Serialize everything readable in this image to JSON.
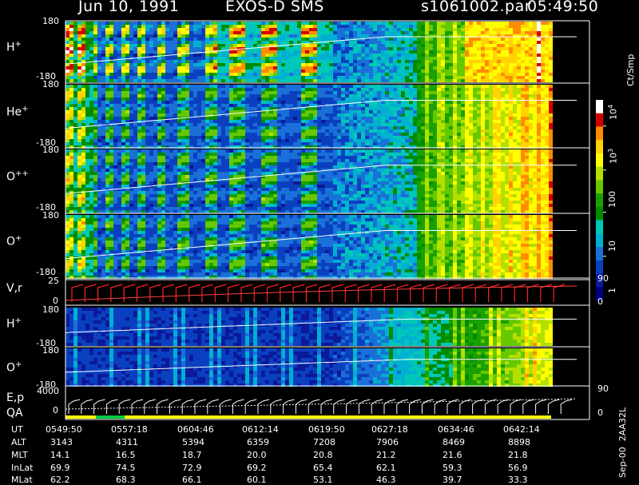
{
  "header": {
    "date": "Jun 10, 1991",
    "instrument": "EXOS-D SMS",
    "file": "s1061002.par",
    "time": "05:49:50"
  },
  "colors": {
    "background": "#000000",
    "text": "#ffffff",
    "velocity_trace": "#ff2020",
    "energy_trace": "#ffffff",
    "qa_bar": "#ffff00",
    "qa_good": "#00cc44"
  },
  "panels": [
    {
      "id": "H+",
      "species": "H",
      "charge": "+",
      "ymax": "180",
      "ymin": "-180"
    },
    {
      "id": "He+",
      "species": "He",
      "charge": "+",
      "ymax": "180",
      "ymin": "-180"
    },
    {
      "id": "O++",
      "species": "O",
      "charge": "++",
      "ymax": "180",
      "ymin": "-180"
    },
    {
      "id": "O+",
      "species": "O",
      "charge": "+",
      "ymax": "180",
      "ymin": "-180"
    }
  ],
  "lower_panels": [
    {
      "id": "V,r",
      "label": "V,r",
      "ymax": "25",
      "ymin": "0",
      "right_top": "90",
      "right_bottom": "0"
    },
    {
      "id": "H+2",
      "species": "H",
      "charge": "+",
      "ymax": "180",
      "ymin": "-180"
    },
    {
      "id": "O+2",
      "species": "O",
      "charge": "+",
      "ymax": "180",
      "ymin": "-180"
    },
    {
      "id": "E,p",
      "label": "E,p",
      "label2": "QA",
      "ymax": "4000",
      "ymin": "0",
      "right_top": "90",
      "right_bottom": "0"
    }
  ],
  "colorbar": {
    "unit": "Ct/Smp",
    "ticks": [
      {
        "value": 10000,
        "label": "10",
        "exp": "4"
      },
      {
        "value": 1000,
        "label": "10",
        "exp": "3"
      },
      {
        "value": 100,
        "label": "100",
        "exp": ""
      },
      {
        "value": 10,
        "label": "10",
        "exp": ""
      },
      {
        "value": 1,
        "label": "1",
        "exp": ""
      }
    ],
    "scale": "log"
  },
  "footer_id": "Sep-00  2AA32L",
  "table": {
    "row_labels": [
      "UT",
      "ALT",
      "MLT",
      "InLat",
      "MLat"
    ],
    "columns": [
      [
        "0549:50",
        "3143",
        "14.1",
        "69.9",
        "62.2"
      ],
      [
        "0557:18",
        "4311",
        "16.5",
        "74.5",
        "68.3"
      ],
      [
        "0604:46",
        "5394",
        "18.7",
        "72.9",
        "66.1"
      ],
      [
        "0612:14",
        "6359",
        "20.0",
        "69.2",
        "60.1"
      ],
      [
        "0619:50",
        "7208",
        "20.8",
        "65.4",
        "53.1"
      ],
      [
        "0627:18",
        "7906",
        "21.2",
        "62.1",
        "46.3"
      ],
      [
        "0634:46",
        "8469",
        "21.6",
        "59.3",
        "39.7"
      ],
      [
        "0642:14",
        "8898",
        "21.8",
        "56.9",
        "33.3"
      ]
    ]
  },
  "chart_data": {
    "type": "heatmap",
    "title": "Jun 10, 1991   EXOS-D SMS",
    "x": [
      "0549:50",
      "0557:18",
      "0604:46",
      "0612:14",
      "0619:50",
      "0627:18",
      "0634:46",
      "0642:14"
    ],
    "xlabel": "UT",
    "ylabel_panels": [
      "H+",
      "He+",
      "O++",
      "O+",
      "V,r",
      "H+",
      "O+",
      "E,p / QA"
    ],
    "pitch_angle_range": [
      -180,
      180
    ],
    "colorbar_range": [
      1,
      10000
    ],
    "colorbar_unit": "Ct/Smp"
  }
}
